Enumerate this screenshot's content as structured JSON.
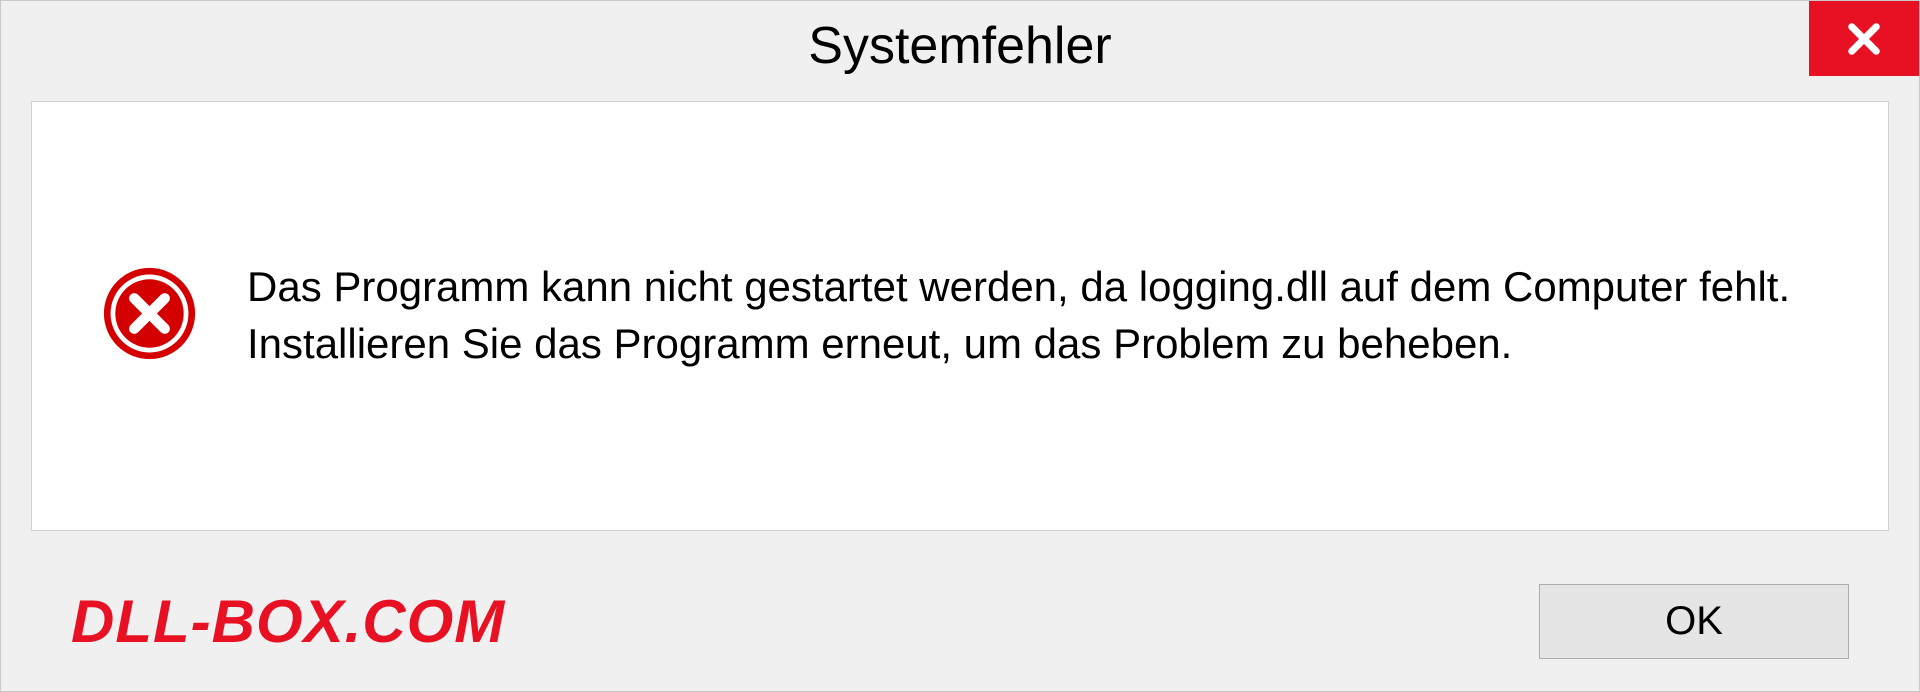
{
  "dialog": {
    "title": "Systemfehler",
    "message": "Das Programm kann nicht gestartet werden, da logging.dll auf dem Computer fehlt. Installieren Sie das Programm erneut, um das Problem zu beheben.",
    "ok_label": "OK"
  },
  "watermark": "DLL-BOX.COM"
}
